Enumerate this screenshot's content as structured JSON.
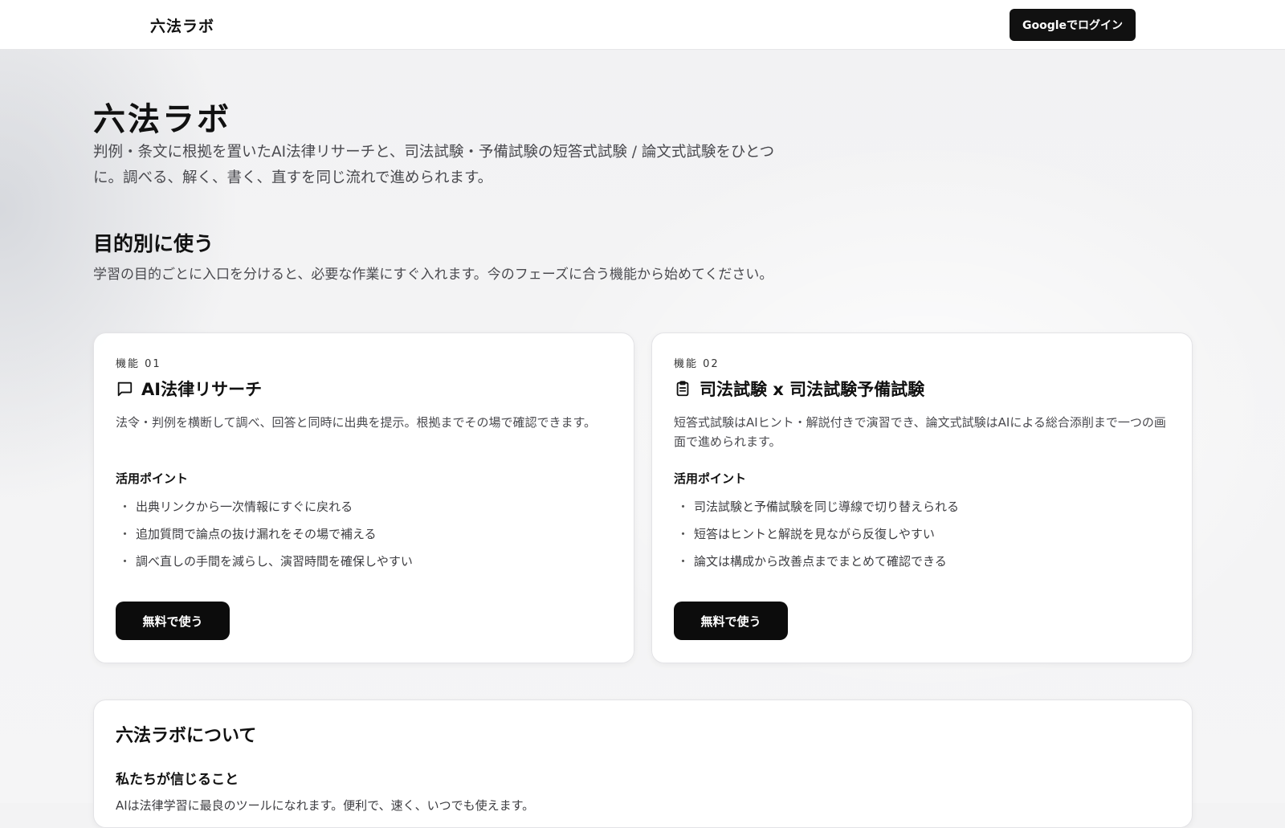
{
  "header": {
    "brand": "六法ラボ",
    "login_label": "Googleでログイン"
  },
  "hero": {
    "title": "六法ラボ",
    "description": "判例・条文に根拠を置いたAI法律リサーチと、司法試験・予備試験の短答式試験 / 論文式試験をひとつに。調べる、解く、書く、直すを同じ流れで進められます。"
  },
  "section": {
    "title": "目的別に使う",
    "description": "学習の目的ごとに入口を分けると、必要な作業にすぐ入れます。今のフェーズに合う機能から始めてください。"
  },
  "features": [
    {
      "kicker": "機能 01",
      "icon": "chat-bubble-icon",
      "title": "AI法律リサーチ",
      "description": "法令・判例を横断して調べ、回答と同時に出典を提示。根拠までその場で確認できます。",
      "points_heading": "活用ポイント",
      "points": [
        "出典リンクから一次情報にすぐに戻れる",
        "追加質問で論点の抜け漏れをその場で補える",
        "調べ直しの手間を減らし、演習時間を確保しやすい"
      ],
      "cta": "無料で使う"
    },
    {
      "kicker": "機能 02",
      "icon": "clipboard-icon",
      "title": "司法試験 x 司法試験予備試験",
      "description": "短答式試験はAIヒント・解説付きで演習でき、論文式試験はAIによる総合添削まで一つの画面で進められます。",
      "points_heading": "活用ポイント",
      "points": [
        "司法試験と予備試験を同じ導線で切り替えられる",
        "短答はヒントと解説を見ながら反復しやすい",
        "論文は構成から改善点までまとめて確認できる"
      ],
      "cta": "無料で使う"
    }
  ],
  "bullet_glyph": "・",
  "about": {
    "title": "六法ラボについて",
    "subhead": "私たちが信じること",
    "text": "AIは法律学習に最良のツールになれます。便利で、速く、いつでも使えます。"
  },
  "colors": {
    "primary_button": "#111111",
    "page_background": "#f3f3f4",
    "card_background": "#ffffff"
  }
}
